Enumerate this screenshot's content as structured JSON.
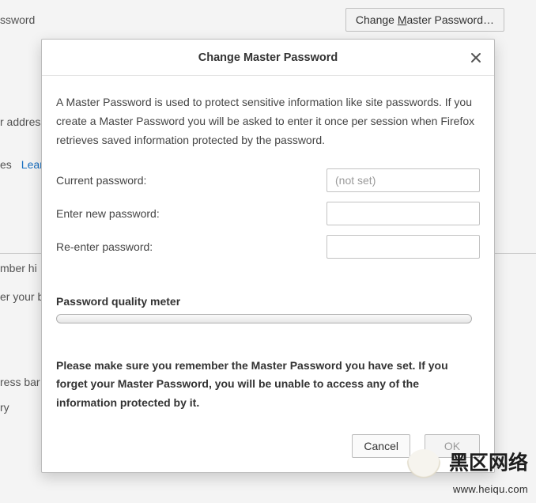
{
  "background": {
    "password_label_fragment": "ssword",
    "change_master_button_prefix": "Change ",
    "change_master_button_accel": "M",
    "change_master_button_suffix": "aster Password…",
    "addresses_fragment": "r addresses",
    "es_fragment": "es",
    "learn_more": "Lear",
    "history_heading": "mber hi",
    "browsing_fragment": "er your b",
    "address_bar_fragment": "ress bar",
    "ry_fragment": "ry"
  },
  "dialog": {
    "title": "Change Master Password",
    "intro": "A Master Password is used to protect sensitive information like site passwords. If you create a Master Password you will be asked to enter it once per session when Firefox retrieves saved information protected by the password.",
    "current_label": "Current password:",
    "current_placeholder": "(not set)",
    "enter_new_label": "Enter new password:",
    "reenter_label": "Re-enter password:",
    "quality_label": "Password quality meter",
    "warning": "Please make sure you remember the Master Password you have set. If you forget your Master Password, you will be unable to access any of the information protected by it.",
    "cancel": "Cancel",
    "ok": "OK"
  },
  "watermark": {
    "main": "黑区网络",
    "sub": "www.heiqu.com"
  }
}
